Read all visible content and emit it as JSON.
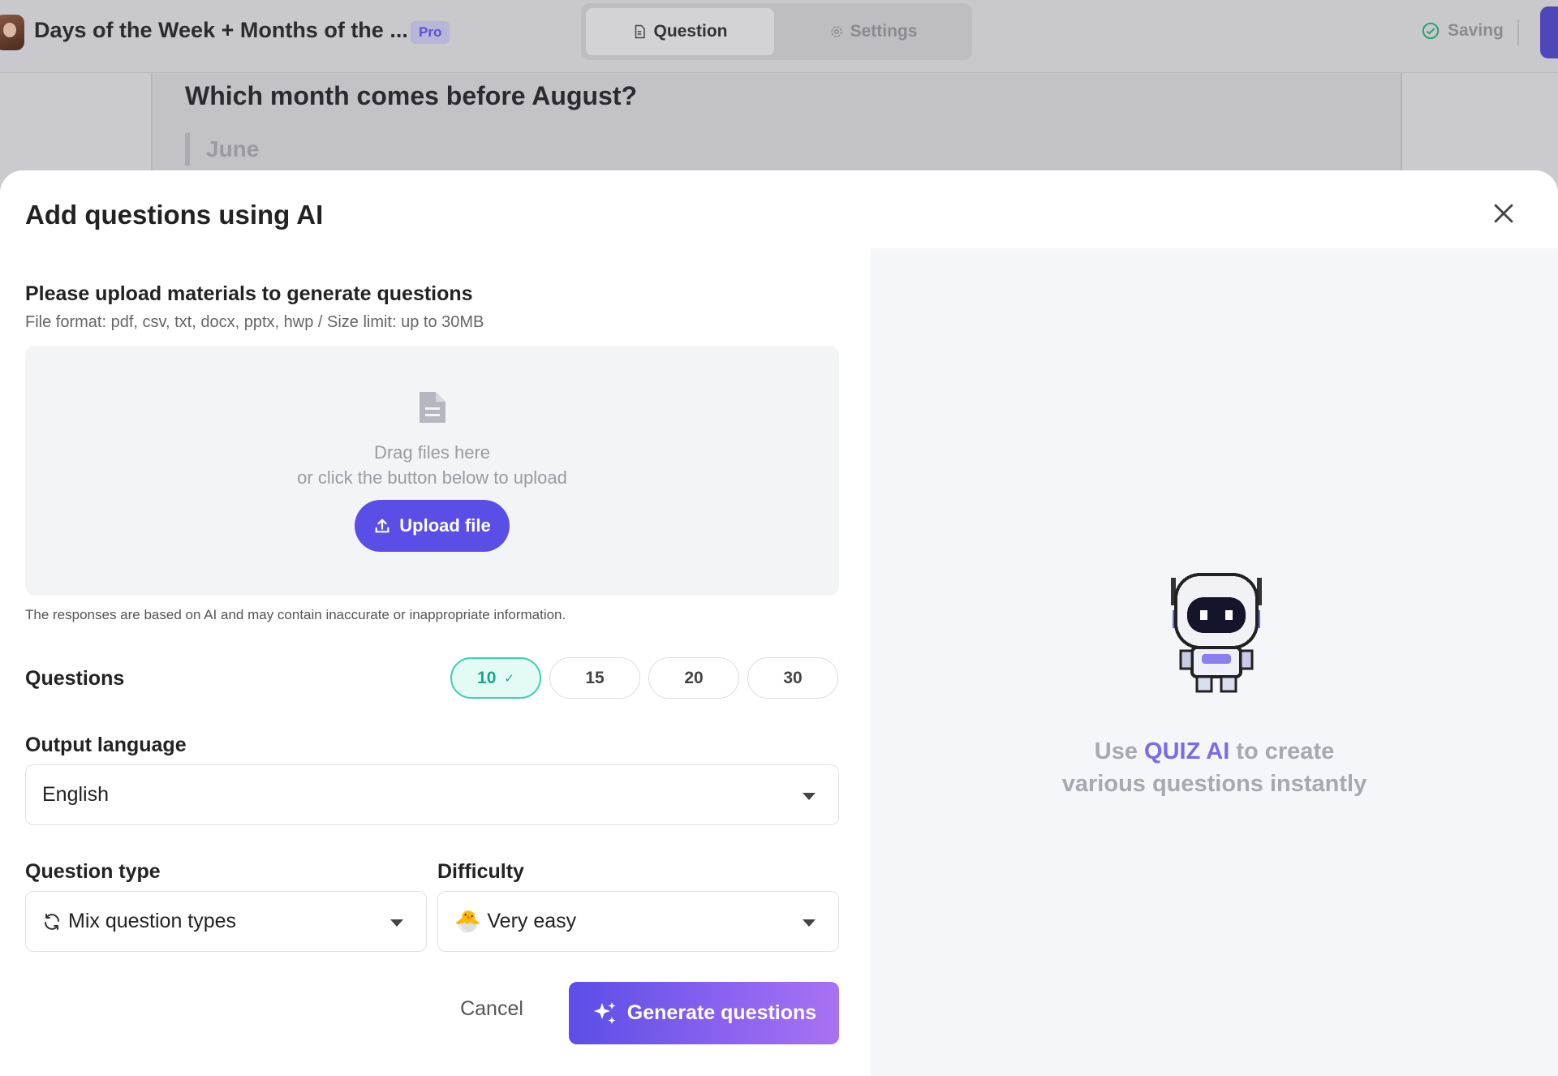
{
  "topbar": {
    "title": "Days of the Week + Months of the ...",
    "badge": "Pro",
    "tabs": [
      {
        "label": "Question",
        "icon": "document-icon",
        "active": true
      },
      {
        "label": "Settings",
        "icon": "gear-icon",
        "active": false
      }
    ],
    "status": "Saving"
  },
  "question": {
    "title": "Which month comes before August?",
    "answer": "June"
  },
  "modal": {
    "title": "Add questions using AI",
    "upload": {
      "title": "Please upload materials to generate questions",
      "subtitle": "File format: pdf, csv, txt, docx, pptx, hwp / Size limit: up to 30MB",
      "drop_line1": "Drag files here",
      "drop_line2": "or click the button below to upload",
      "button": "Upload file"
    },
    "disclaimer": "The responses are based on AI and may contain inaccurate or inappropriate information.",
    "questions": {
      "label": "Questions",
      "options": [
        "10",
        "15",
        "20",
        "30"
      ],
      "selected": "10"
    },
    "language": {
      "label": "Output language",
      "value": "English"
    },
    "question_type": {
      "label": "Question type",
      "value": "Mix question types"
    },
    "difficulty": {
      "label": "Difficulty",
      "emoji": "🐣",
      "value": "Very easy"
    },
    "cancel": "Cancel",
    "generate": "Generate questions",
    "promo": {
      "prefix": "Use ",
      "accent": "QUIZ AI",
      "suffix": " to create",
      "line2": "various questions instantly"
    }
  },
  "colors": {
    "primary": "#5b4ee6",
    "accent_text": "#7a6be8",
    "selected_pill_bg": "#e4fbf5",
    "selected_pill_border": "#3ccfb0"
  }
}
